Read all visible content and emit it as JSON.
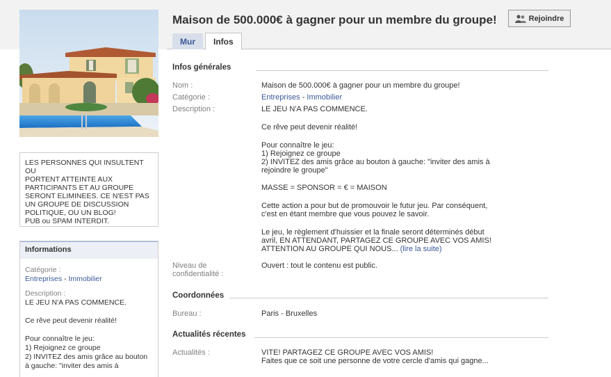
{
  "group": {
    "title": "Maison de 500.000€ à gagner pour un membre du groupe!",
    "join_label": "Rejoindre"
  },
  "tabs": [
    {
      "label": "Mur"
    },
    {
      "label": "Infos"
    }
  ],
  "sidebar": {
    "notice": "LES PERSONNES QUI INSULTENT OU\nPORTENT ATTEINTE AUX\nPARTICIPANTS ET AU GROUPE\nSERONT ELIMINEES. CE N'EST PAS\nUN GROUPE DE DISCUSSION\nPOLITIQUE, OU UN BLOG!\nPUB ou SPAM INTERDIT.",
    "info_title": "Informations",
    "category_label": "Catégorie :",
    "category_1": "Entreprises",
    "category_sep": " - ",
    "category_2": "Immobilier",
    "description_label": "Description :",
    "description": "LE JEU N'A PAS COMMENCE.\n\nCe rêve peut devenir réalité!\n\nPour connaître le jeu:\n1) Rejoignez ce groupe\n2) INVITEZ des amis grâce au bouton\nà gauche: \"inviter des amis à"
  },
  "info": {
    "general_title": "Infos générales",
    "name_label": "Nom :",
    "name_value": "Maison de 500.000€ à gagner pour un membre du groupe!",
    "category_label": "Catégorie :",
    "category_1": "Entreprises",
    "category_sep": " - ",
    "category_2": "Immobilier",
    "description_label": "Description :",
    "desc_p1": "LE JEU N'A PAS COMMENCE.",
    "desc_p2": "Ce rêve peut devenir réalité!",
    "desc_p3": "Pour connaître le jeu:\n1) Rejoignez ce groupe\n2) INVITEZ des amis grâce au bouton à gauche: \"inviter des amis à\nrejoindre le groupe\"",
    "desc_p4": "MASSE = SPONSOR = € = MAISON",
    "desc_p5": "Cette action a pour but de promouvoir le futur jeu. Par conséquent,\nc'est en étant membre que vous pouvez le savoir.",
    "desc_p6": "Le jeu, le règlement d'huissier et la finale seront déterminés début\navril, EN ATTENDANT, PARTAGEZ CE GROUPE AVEC VOS AMIS!\nATTENTION AU GROUPE QUI NOUS...",
    "read_more": "(lire la suite)",
    "privacy_label": "Niveau de\nconfidentialité :",
    "privacy_value": "Ouvert : tout le contenu est public.",
    "contact_title": "Coordonnées",
    "office_label": "Bureau :",
    "office_value": "Paris - Bruxelles",
    "news_title": "Actualités récentes",
    "news_label": "Actualités :",
    "news_value": "VITE! PARTAGEZ CE GROUPE AVEC VOS AMIS!\nFaites que ce soit une personne de votre cercle d'amis qui gagne..."
  },
  "colors": {
    "link": "#3b5998",
    "tab_inactive_bg": "#d8dfea",
    "header_bg": "#eceff5"
  },
  "icons": {
    "join": "add-friend-icon"
  }
}
